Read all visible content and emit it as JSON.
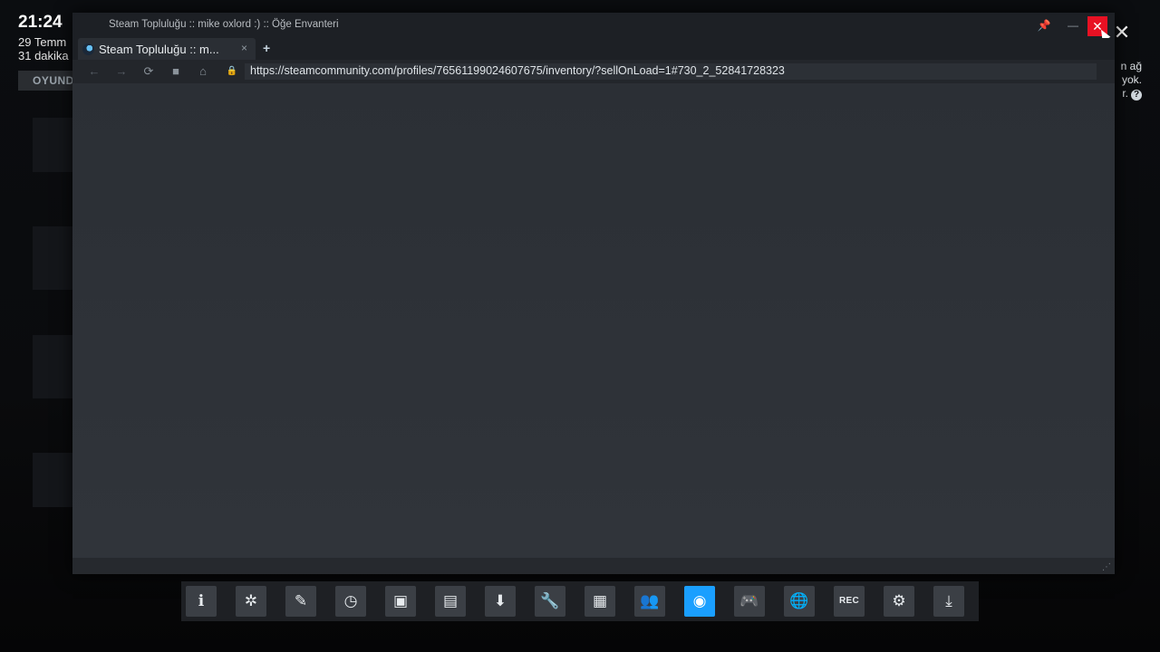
{
  "overlay": {
    "clock": "21:24",
    "date_line1": "29 Temm",
    "date_line2": "31 dakika",
    "play_button": "OYUND",
    "right_line1": "n ağ",
    "right_line2": "yok.",
    "right_line3": "r.",
    "help_glyph": "?",
    "close_glyph": "✕"
  },
  "window": {
    "title": "Steam Topluluğu :: mike oxlord :) :: Öğe Envanteri",
    "pin_glyph": "📌",
    "minimize_glyph": "—",
    "close_glyph": "✕"
  },
  "tabs": [
    {
      "label": "Steam Topluluğu :: m...",
      "close_glyph": "×"
    }
  ],
  "new_tab_glyph": "+",
  "nav": {
    "back_glyph": "←",
    "forward_glyph": "→",
    "reload_glyph": "⟳",
    "bookmark_glyph": "■",
    "home_glyph": "⌂",
    "lock_glyph": "🔒",
    "url": "https://steamcommunity.com/profiles/76561199024607675/inventory/?sellOnLoad=1#730_2_52841728323"
  },
  "statusbar": {
    "grip_glyph": "⋰"
  },
  "taskbar": {
    "buttons": [
      {
        "icon": "info-icon",
        "glyph": "ℹ"
      },
      {
        "icon": "achievements-icon",
        "glyph": "✲"
      },
      {
        "icon": "notes-icon",
        "glyph": "✎"
      },
      {
        "icon": "timer-icon",
        "glyph": "◷"
      },
      {
        "icon": "guides-icon",
        "glyph": "▣"
      },
      {
        "icon": "chat-icon",
        "glyph": "▤"
      },
      {
        "icon": "download-icon",
        "glyph": "⬇"
      },
      {
        "icon": "tools-icon",
        "glyph": "🔧"
      },
      {
        "icon": "screenshots-icon",
        "glyph": "▦"
      },
      {
        "icon": "friends-icon",
        "glyph": "👥"
      },
      {
        "icon": "browser-eye-icon",
        "glyph": "◉",
        "active": true
      },
      {
        "icon": "controller-icon",
        "glyph": "🎮",
        "disabled": true
      },
      {
        "icon": "globe-icon",
        "glyph": "🌐"
      },
      {
        "icon": "record-icon",
        "glyph": "REC"
      },
      {
        "icon": "settings-icon",
        "glyph": "⚙"
      },
      {
        "icon": "minimize-overlay-icon",
        "glyph": "⤓"
      }
    ],
    "active_color": "#1a9fff"
  }
}
